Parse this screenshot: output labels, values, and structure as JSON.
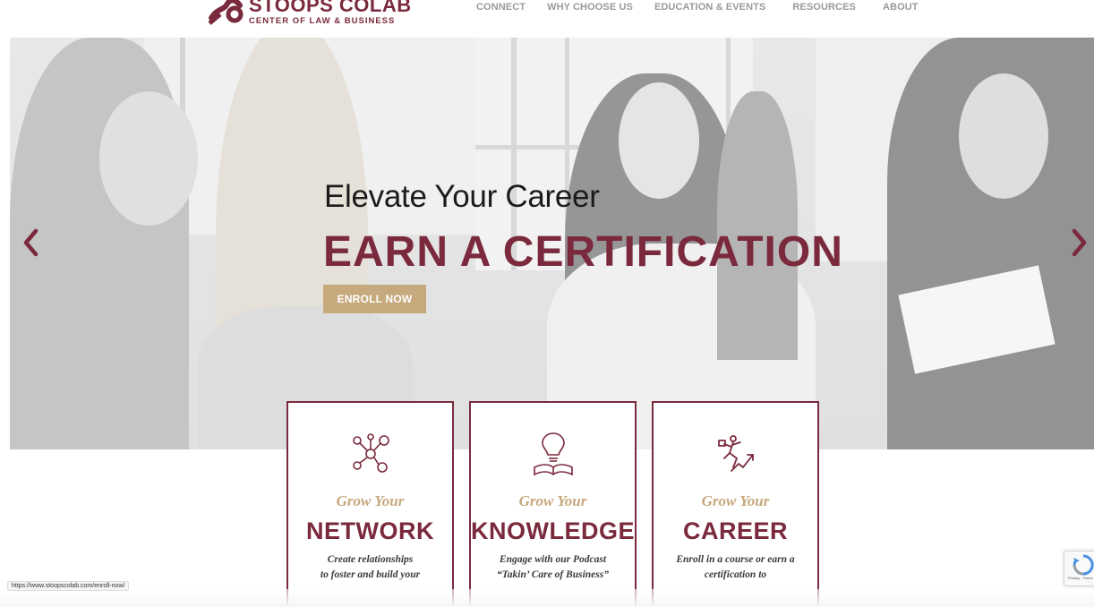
{
  "header": {
    "logo_title": "STOOPS COLAB",
    "logo_subtitle": "CENTER OF LAW & BUSINESS",
    "nav": [
      "CONNECT",
      "WHY CHOOSE US",
      "EDUCATION & EVENTS",
      "RESOURCES",
      "ABOUT"
    ]
  },
  "hero": {
    "subtitle": "Elevate Your Career",
    "title": "EARN A CERTIFICATION",
    "button": "ENROLL NOW",
    "prev_icon": "chevron-left-icon",
    "next_icon": "chevron-right-icon"
  },
  "cards": [
    {
      "icon": "network-icon",
      "grow": "Grow Your",
      "heading": "NETWORK",
      "desc1": "Create relationships",
      "desc2": "to foster and build your"
    },
    {
      "icon": "lightbulb-book-icon",
      "grow": "Grow Your",
      "heading": "KNOWLEDGE",
      "desc1": "Engage with our Podcast",
      "desc2": "“Takin’ Care of Business”"
    },
    {
      "icon": "career-growth-icon",
      "grow": "Grow Your",
      "heading": "CAREER",
      "desc1": "Enroll in a course or earn a",
      "desc2": "certification to"
    }
  ],
  "status_url": "https://www.stoopscolab.com/enroll-now/",
  "recaptcha": {
    "icon": "recaptcha-icon",
    "text": "Privacy - Terms"
  },
  "colors": {
    "brand": "#7a2a3c",
    "gold": "#c6a97c",
    "nav": "#9a9a9a"
  }
}
